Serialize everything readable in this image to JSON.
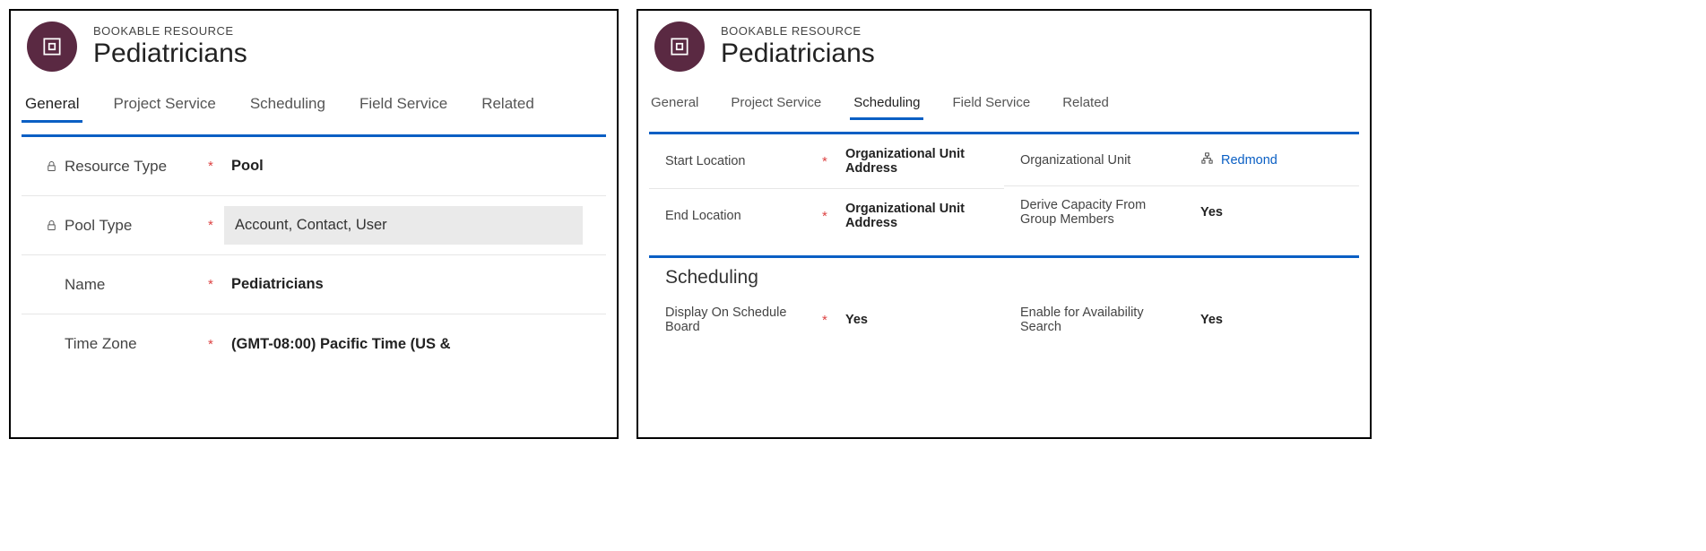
{
  "left": {
    "header": {
      "label": "BOOKABLE RESOURCE",
      "title": "Pediatricians"
    },
    "tabs": [
      {
        "label": "General",
        "active": true
      },
      {
        "label": "Project Service",
        "active": false
      },
      {
        "label": "Scheduling",
        "active": false
      },
      {
        "label": "Field Service",
        "active": false
      },
      {
        "label": "Related",
        "active": false
      }
    ],
    "fields": {
      "resource_type": {
        "label": "Resource Type",
        "value": "Pool",
        "locked": true,
        "required": true
      },
      "pool_type": {
        "label": "Pool Type",
        "value": "Account, Contact, User",
        "locked": true,
        "required": true,
        "highlighted": true
      },
      "name": {
        "label": "Name",
        "value": "Pediatricians",
        "required": true
      },
      "time_zone": {
        "label": "Time Zone",
        "value": "(GMT-08:00) Pacific Time (US &",
        "required": true
      }
    }
  },
  "right": {
    "header": {
      "label": "BOOKABLE RESOURCE",
      "title": "Pediatricians"
    },
    "tabs": [
      {
        "label": "General",
        "active": false
      },
      {
        "label": "Project Service",
        "active": false
      },
      {
        "label": "Scheduling",
        "active": true
      },
      {
        "label": "Field Service",
        "active": false
      },
      {
        "label": "Related",
        "active": false
      }
    ],
    "section1": {
      "start_location": {
        "label": "Start Location",
        "value": "Organizational Unit Address",
        "required": true
      },
      "end_location": {
        "label": "End Location",
        "value": "Organizational Unit Address",
        "required": true
      },
      "org_unit": {
        "label": "Organizational Unit",
        "value": "Redmond"
      },
      "derive_capacity": {
        "label": "Derive Capacity From Group Members",
        "value": "Yes"
      }
    },
    "section2": {
      "title": "Scheduling",
      "display_on_board": {
        "label": "Display On Schedule Board",
        "value": "Yes",
        "required": true
      },
      "enable_avail": {
        "label": "Enable for Availability Search",
        "value": "Yes"
      }
    }
  }
}
